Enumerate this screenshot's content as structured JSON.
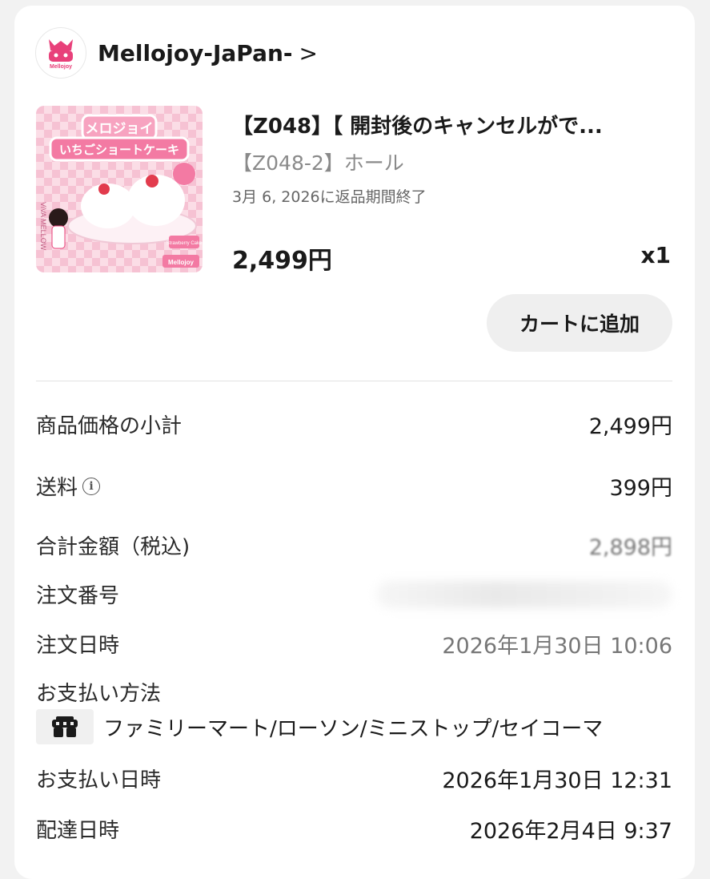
{
  "shop": {
    "name": "Mellojoy-JaPan-",
    "chevron": ">",
    "avatar_text": "Mellojoy"
  },
  "product": {
    "thumbnail": {
      "title_line1": "メロジョイ",
      "title_line2": "いちごショートケーキ",
      "side_text": "ViVA MELLOW",
      "badge_text": "Strawberry Cake",
      "brand": "Mellojoy"
    },
    "title": "【Z048】【 開封後のキャンセルがで...",
    "variant": "【Z048-2】ホール",
    "return_deadline": "3月 6, 2026に返品期間終了",
    "price": "2,499円",
    "quantity": "x1",
    "add_to_cart_label": "カートに追加"
  },
  "summary": {
    "subtotal_label": "商品価格の小計",
    "subtotal_value": "2,499円",
    "shipping_label": "送料",
    "shipping_info_icon": "i",
    "shipping_value": "399円",
    "total_label": "合計金額（税込)",
    "total_value": "2,898円",
    "order_number_label": "注文番号",
    "order_date_label": "注文日時",
    "order_date_value": "2026年1月30日 10:06",
    "payment_method_label": "お支払い方法",
    "payment_method_icon": "convenience-store-icon",
    "payment_method_value": "ファミリーマート/ローソン/ミニストップ/セイコーマ",
    "payment_date_label": "お支払い日時",
    "payment_date_value": "2026年1月30日 12:31",
    "delivery_date_label": "配達日時",
    "delivery_date_value": "2026年2月4日 9:37"
  },
  "colors": {
    "background": "#f2f2f2",
    "card": "#ffffff",
    "button": "#efefef",
    "thumbnail_pink": "#f7c6d6",
    "brand_pink": "#e8407a"
  }
}
